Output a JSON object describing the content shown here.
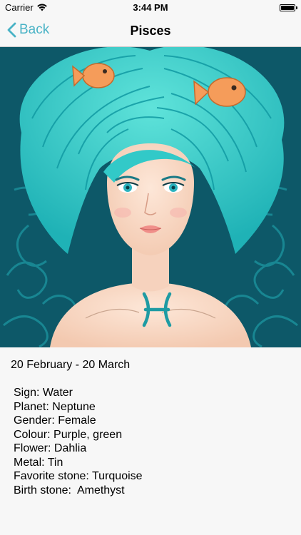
{
  "status_bar": {
    "carrier": "Carrier",
    "time": "3:44 PM",
    "wifi_icon": "wifi-icon",
    "battery_icon": "battery-icon",
    "battery_level": 1.0
  },
  "nav": {
    "back_label": "Back",
    "back_icon": "chevron-left-icon",
    "title": "Pisces",
    "accent_color": "#4ab3c6"
  },
  "content": {
    "date_range": "20 February - 20 March",
    "facts": [
      "Sign: Water",
      "Planet: Neptune",
      "Gender: Female",
      "Colour: Purple, green",
      "Flower: Dahlia",
      "Metal: Tin",
      "Favorite stone: Turquoise",
      "Birth stone:  Amethyst"
    ]
  }
}
